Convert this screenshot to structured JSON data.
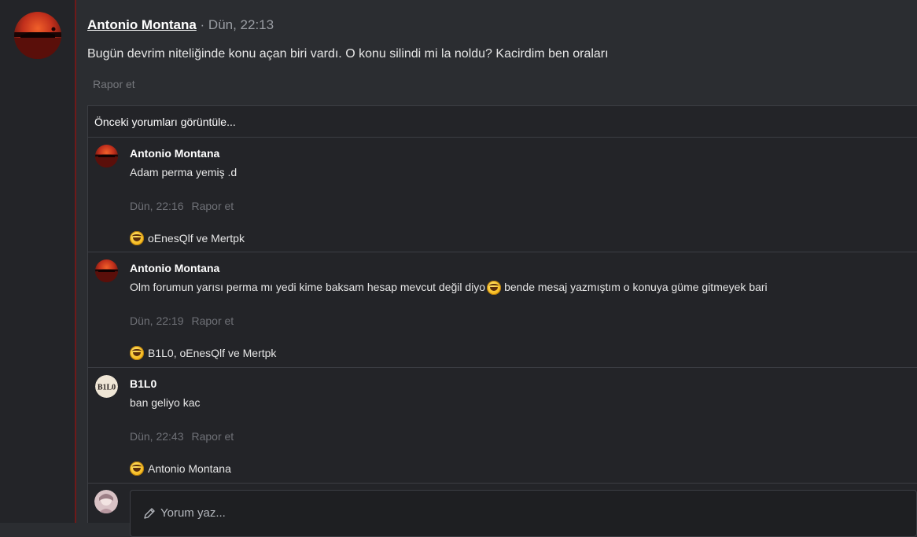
{
  "post": {
    "author": "Antonio Montana",
    "separator": " · ",
    "time": "Dün, 22:13",
    "body": "Bugün devrim niteliğinde konu açan biri vardı. O konu silindi mi la noldu? Kacirdim ben oraları",
    "report": "Rapor et"
  },
  "comments": {
    "prev_label": "Önceki yorumları görüntüle...",
    "items": [
      {
        "author": "Antonio Montana",
        "text": "Adam perma yemiş .d",
        "time": "Dün, 22:16",
        "report": "Rapor et",
        "reactions": "oEnesQlf ve Mertpk"
      },
      {
        "author": "Antonio Montana",
        "text_before": "Olm forumun yarısı perma mı yedi kime baksam hesap mevcut değil diyo",
        "text_after": "bende mesaj yazmıştım o konuya güme gitmeyek bari",
        "time": "Dün, 22:19",
        "report": "Rapor et",
        "reactions": "B1L0, oEnesQlf ve Mertpk"
      },
      {
        "author": "B1L0",
        "text": "ban geliyo kac",
        "time": "Dün, 22:43",
        "report": "Rapor et",
        "reactions": "Antonio Montana"
      }
    ],
    "write_placeholder": "Yorum yaz..."
  },
  "icons": {
    "reaction": "rofl-emoji-icon",
    "pencil": "pencil-icon"
  },
  "colors": {
    "background": "#2b2d31",
    "panel": "#232428",
    "accent_border": "#6e1a1a"
  },
  "avatars": {
    "b1l0_text": "B1L0"
  }
}
